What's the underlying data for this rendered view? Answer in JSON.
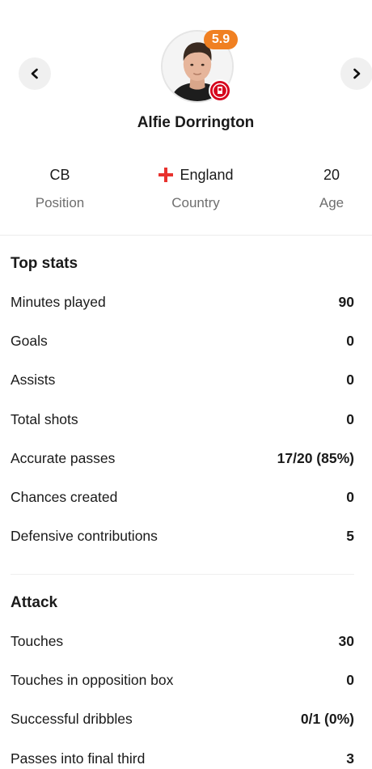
{
  "player": {
    "name": "Alfie Dorrington",
    "rating": "5.9",
    "rating_color": "#f08022",
    "club_badge_color": "#d6001c"
  },
  "info": {
    "position_value": "CB",
    "position_label": "Position",
    "country_value": "England",
    "country_label": "Country",
    "age_value": "20",
    "age_label": "Age"
  },
  "top_stats": {
    "title": "Top stats",
    "rows": [
      {
        "label": "Minutes played",
        "value": "90"
      },
      {
        "label": "Goals",
        "value": "0"
      },
      {
        "label": "Assists",
        "value": "0"
      },
      {
        "label": "Total shots",
        "value": "0"
      },
      {
        "label": "Accurate passes",
        "value": "17/20 (85%)"
      },
      {
        "label": "Chances created",
        "value": "0"
      },
      {
        "label": "Defensive contributions",
        "value": "5"
      }
    ]
  },
  "attack": {
    "title": "Attack",
    "rows": [
      {
        "label": "Touches",
        "value": "30"
      },
      {
        "label": "Touches in opposition box",
        "value": "0"
      },
      {
        "label": "Successful dribbles",
        "value": "0/1 (0%)"
      },
      {
        "label": "Passes into final third",
        "value": "3"
      }
    ]
  }
}
